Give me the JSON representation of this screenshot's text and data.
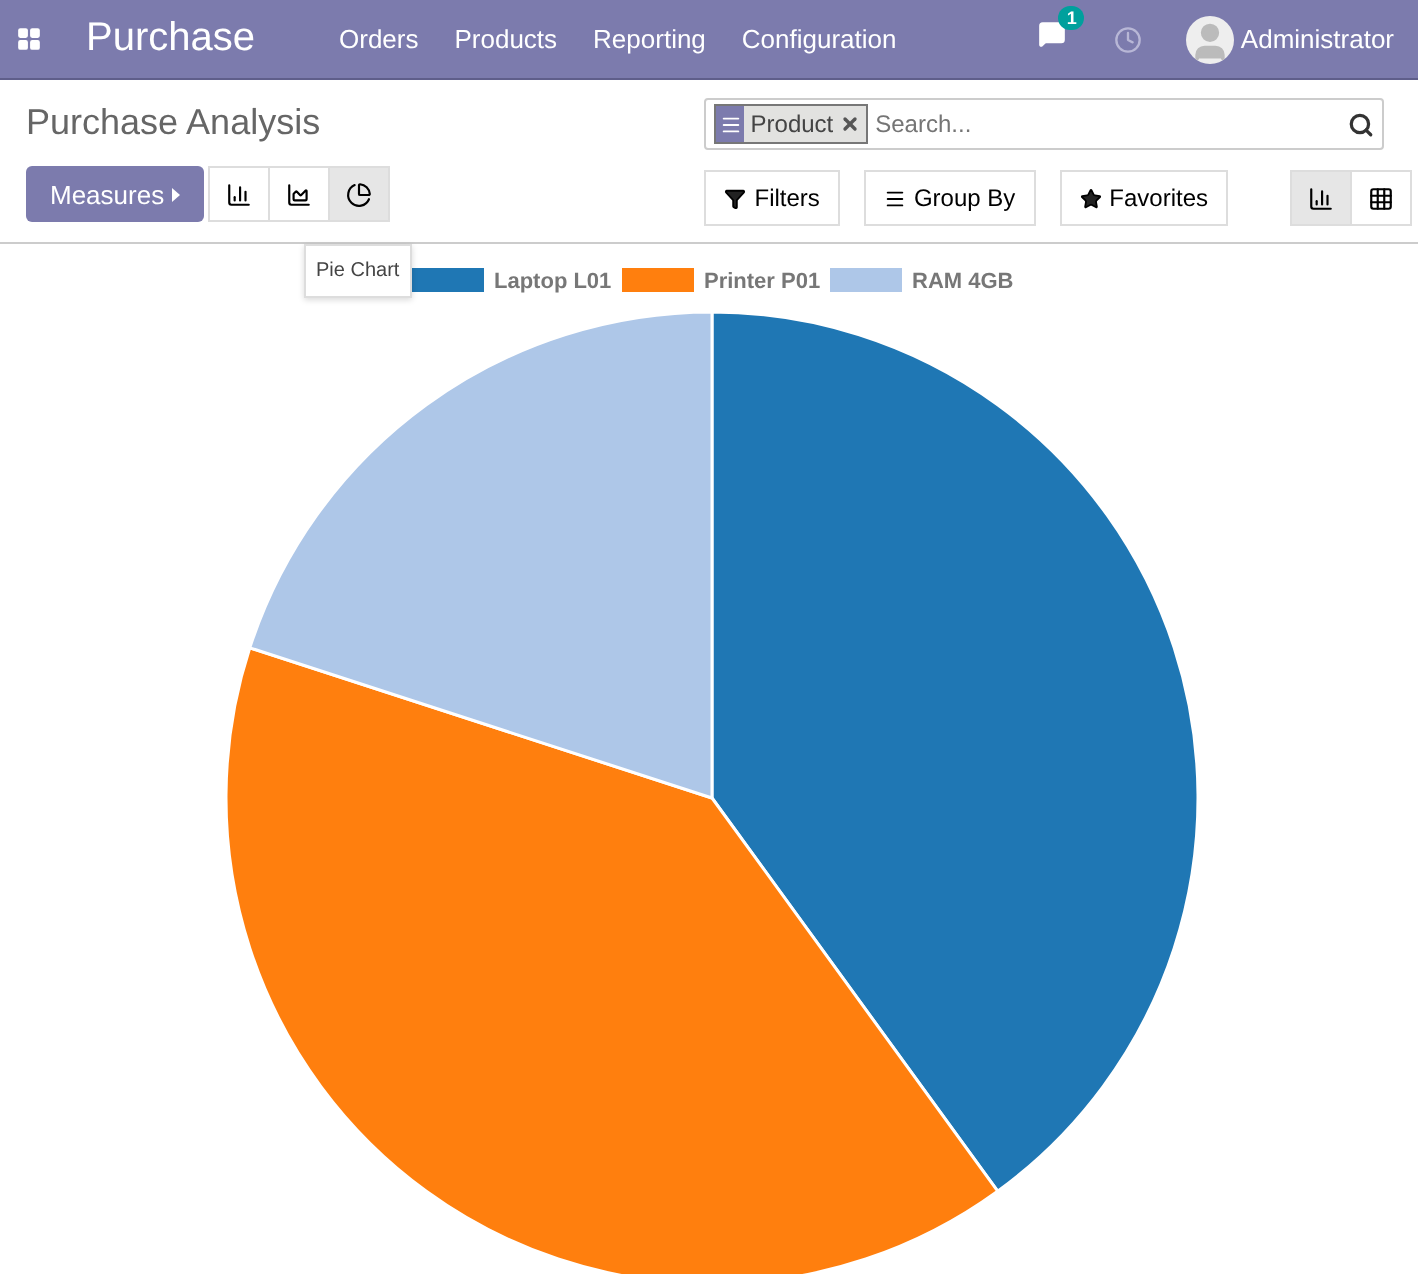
{
  "navbar": {
    "app_title": "Purchase",
    "menu": [
      "Orders",
      "Products",
      "Reporting",
      "Configuration"
    ],
    "messages_count": "1",
    "user": "Administrator"
  },
  "breadcrumb": "Purchase Analysis",
  "measures_button": "Measures",
  "chart_types": [
    {
      "kind": "bar",
      "selected": false
    },
    {
      "kind": "line",
      "selected": false
    },
    {
      "kind": "pie",
      "selected": true
    }
  ],
  "tooltip": "Pie Chart",
  "search": {
    "facets": [
      {
        "label": "Product"
      }
    ],
    "placeholder": "Search..."
  },
  "search_buttons": [
    {
      "kind": "filter",
      "label": "Filters"
    },
    {
      "kind": "groupby",
      "label": "Group By"
    },
    {
      "kind": "favorite",
      "label": "Favorites"
    }
  ],
  "view_switcher": [
    {
      "kind": "graph",
      "selected": true
    },
    {
      "kind": "pivot",
      "selected": false
    }
  ],
  "chart": {
    "chart_data": {
      "type": "pie",
      "categories": [
        "Laptop L01",
        "Printer P01",
        "RAM 4GB"
      ],
      "colors": [
        "#1f77b4",
        "#ff7f0e",
        "#aec7e8"
      ],
      "legend": "top",
      "values": [
        40,
        40,
        20
      ]
    }
  }
}
